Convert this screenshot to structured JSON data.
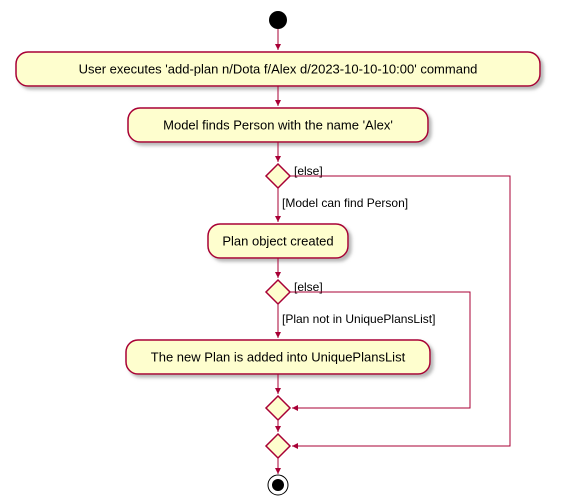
{
  "nodes": {
    "box1": "User executes 'add-plan n/Dota f/Alex d/2023-10-10-10:00' command",
    "box2": "Model finds Person with the name 'Alex'",
    "box3": "Plan object created",
    "box4": "The new Plan is added into UniquePlansList"
  },
  "labels": {
    "d1_else": "[else]",
    "d1_true": "[Model can find Person]",
    "d2_else": "[else]",
    "d2_true": "[Plan not in UniquePlansList]"
  }
}
